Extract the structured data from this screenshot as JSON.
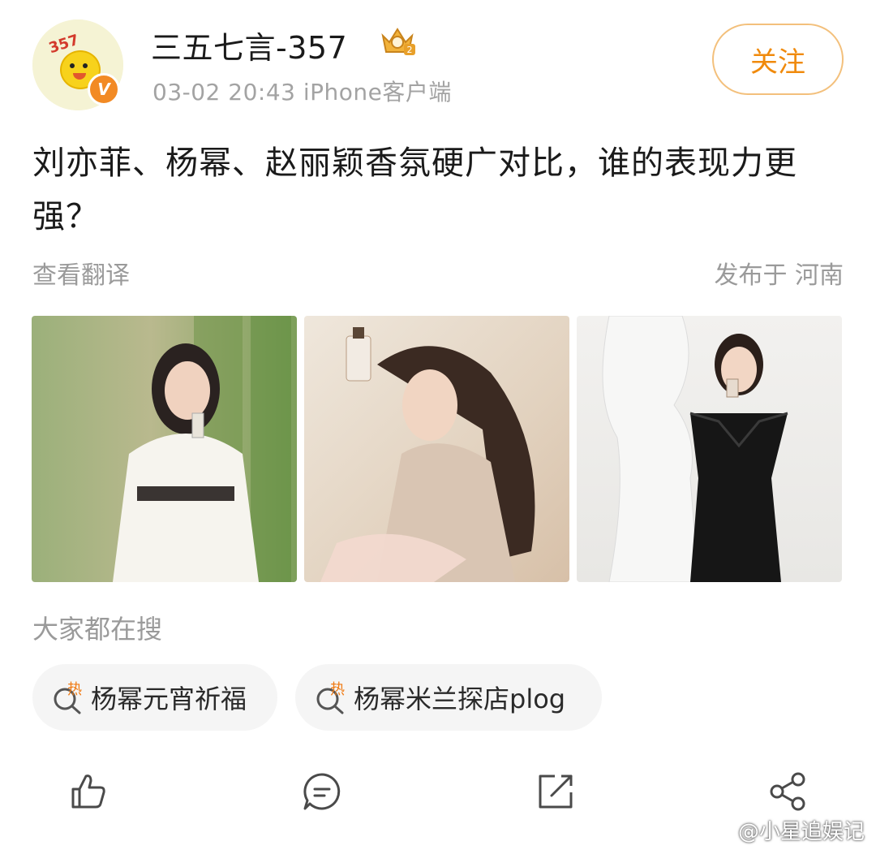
{
  "header": {
    "avatar_text": "357",
    "verified_badge": "V",
    "username": "三五七言-357",
    "meta": "03-02 20:43   iPhone客户端",
    "follow_label": "关注"
  },
  "post": {
    "text": "刘亦菲、杨幂、赵丽颖香氛硬广对比，谁的表现力更强？",
    "translate_label": "查看翻译",
    "location": "发布于 河南"
  },
  "photos": [
    {
      "icon": "photo-liu-yifei"
    },
    {
      "icon": "photo-yang-mi"
    },
    {
      "icon": "photo-zhao-liying"
    }
  ],
  "hot_search": {
    "title": "大家都在搜",
    "chips": [
      {
        "badge": "热",
        "label": "杨幂元宵祈福"
      },
      {
        "badge": "热",
        "label": "杨幂米兰探店plog"
      }
    ]
  },
  "actions": [
    "like-icon",
    "comment-icon",
    "repost-icon",
    "share-icon"
  ],
  "watermark": "@小星追娱记",
  "colors": {
    "accent": "#f08a0c",
    "gray_text": "#9a9a9a",
    "chip_bg": "#f5f5f5"
  }
}
